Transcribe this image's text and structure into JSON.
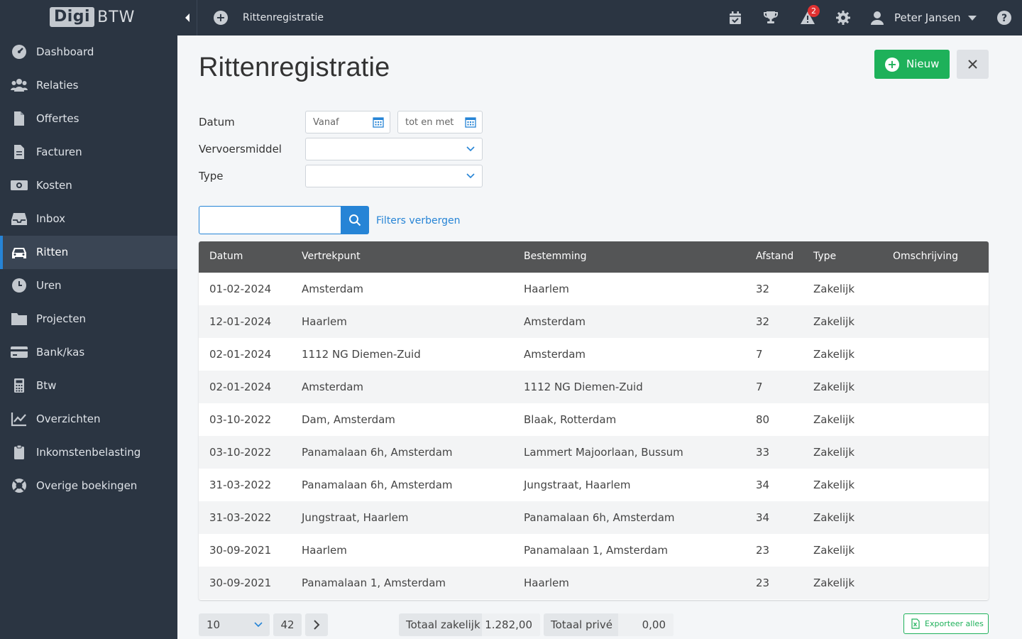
{
  "app": {
    "logo_left": "Digi",
    "logo_right": "BTW",
    "page_breadcrumb": "Rittenregistratie",
    "notification_count": "2",
    "user_name": "Peter Jansen"
  },
  "sidebar": {
    "items": [
      {
        "label": "Dashboard",
        "icon": "dashboard-icon"
      },
      {
        "label": "Relaties",
        "icon": "users-icon"
      },
      {
        "label": "Offertes",
        "icon": "file-icon"
      },
      {
        "label": "Facturen",
        "icon": "invoice-icon"
      },
      {
        "label": "Kosten",
        "icon": "money-icon"
      },
      {
        "label": "Inbox",
        "icon": "inbox-icon"
      },
      {
        "label": "Ritten",
        "icon": "car-icon",
        "active": true
      },
      {
        "label": "Uren",
        "icon": "clock-icon"
      },
      {
        "label": "Projecten",
        "icon": "folder-icon"
      },
      {
        "label": "Bank/kas",
        "icon": "credit-card-icon"
      },
      {
        "label": "Btw",
        "icon": "calculator-icon"
      },
      {
        "label": "Overzichten",
        "icon": "chart-icon"
      },
      {
        "label": "Inkomstenbelasting",
        "icon": "clipboard-icon"
      },
      {
        "label": "Overige boekingen",
        "icon": "lifebuoy-icon"
      }
    ]
  },
  "main": {
    "title": "Rittenregistratie",
    "new_button": "Nieuw",
    "filters": {
      "datum_label": "Datum",
      "datum_from_placeholder": "Vanaf",
      "datum_to_placeholder": "tot en met",
      "vervoersmiddel_label": "Vervoersmiddel",
      "type_label": "Type"
    },
    "search_placeholder": "",
    "filters_toggle": "Filters verbergen"
  },
  "table": {
    "headers": [
      "Datum",
      "Vertrekpunt",
      "Bestemming",
      "Afstand",
      "Type",
      "Omschrijving"
    ],
    "rows": [
      [
        "01-02-2024",
        "Amsterdam",
        "Haarlem",
        "32",
        "Zakelijk",
        ""
      ],
      [
        "12-01-2024",
        "Haarlem",
        "Amsterdam",
        "32",
        "Zakelijk",
        ""
      ],
      [
        "02-01-2024",
        "1112 NG Diemen-Zuid",
        "Amsterdam",
        "7",
        "Zakelijk",
        ""
      ],
      [
        "02-01-2024",
        "Amsterdam",
        "1112 NG Diemen-Zuid",
        "7",
        "Zakelijk",
        ""
      ],
      [
        "03-10-2022",
        "Dam, Amsterdam",
        "Blaak, Rotterdam",
        "80",
        "Zakelijk",
        ""
      ],
      [
        "03-10-2022",
        "Panamalaan 6h, Amsterdam",
        "Lammert Majoorlaan, Bussum",
        "33",
        "Zakelijk",
        ""
      ],
      [
        "31-03-2022",
        "Panamalaan 6h, Amsterdam",
        "Jungstraat, Haarlem",
        "34",
        "Zakelijk",
        ""
      ],
      [
        "31-03-2022",
        "Jungstraat, Haarlem",
        "Panamalaan 6h, Amsterdam",
        "34",
        "Zakelijk",
        ""
      ],
      [
        "30-09-2021",
        "Haarlem",
        "Panamalaan 1, Amsterdam",
        "23",
        "Zakelijk",
        ""
      ],
      [
        "30-09-2021",
        "Panamalaan 1, Amsterdam",
        "Haarlem",
        "23",
        "Zakelijk",
        ""
      ]
    ]
  },
  "footer": {
    "page_size": "10",
    "total_count": "42",
    "totaal_zakelijk_label": "Totaal zakelijk",
    "totaal_zakelijk_value": "1.282,00",
    "totaal_prive_label": "Totaal privé",
    "totaal_prive_value": "0,00",
    "export_label": "Exporteer alles"
  },
  "colors": {
    "sidebar_bg": "#2b3542",
    "accent_blue": "#2684d6",
    "accent_green": "#1eb15a",
    "table_header": "#545556"
  }
}
